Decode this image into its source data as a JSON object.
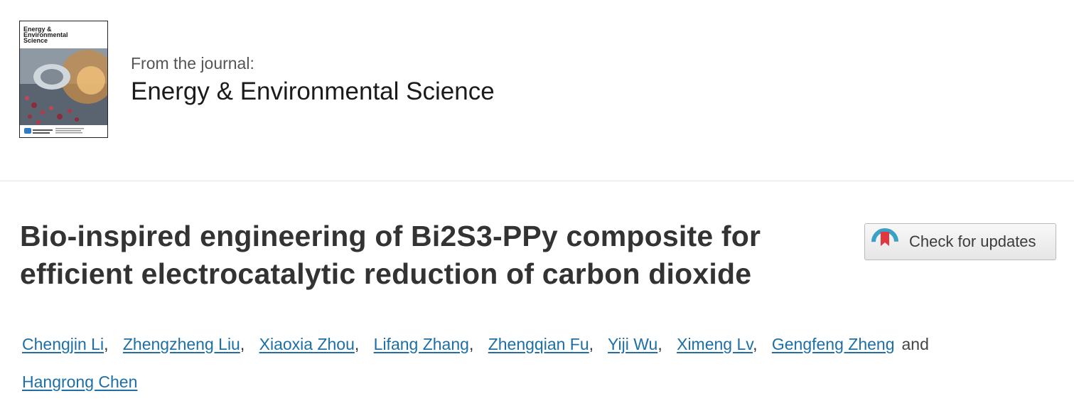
{
  "journal": {
    "cover_title": "Energy & Environmental Science",
    "from_label": "From the journal:",
    "name": "Energy & Environmental Science"
  },
  "article": {
    "title": "Bio-inspired engineering of Bi2S3-PPy composite for efficient electrocatalytic reduction of carbon dioxide"
  },
  "check_updates": {
    "label": "Check for updates"
  },
  "authors": {
    "list": [
      "Chengjin Li",
      "Zhengzheng Liu",
      "Xiaoxia Zhou",
      "Lifang Zhang",
      "Zhengqian Fu",
      "Yiji Wu",
      "Ximeng Lv",
      "Gengfeng Zheng",
      "Hangrong Chen"
    ],
    "separator": ",",
    "and_label": "and"
  },
  "colors": {
    "link": "#1d6fa5",
    "title_text": "#333333",
    "divider": "#e3e3e3"
  }
}
